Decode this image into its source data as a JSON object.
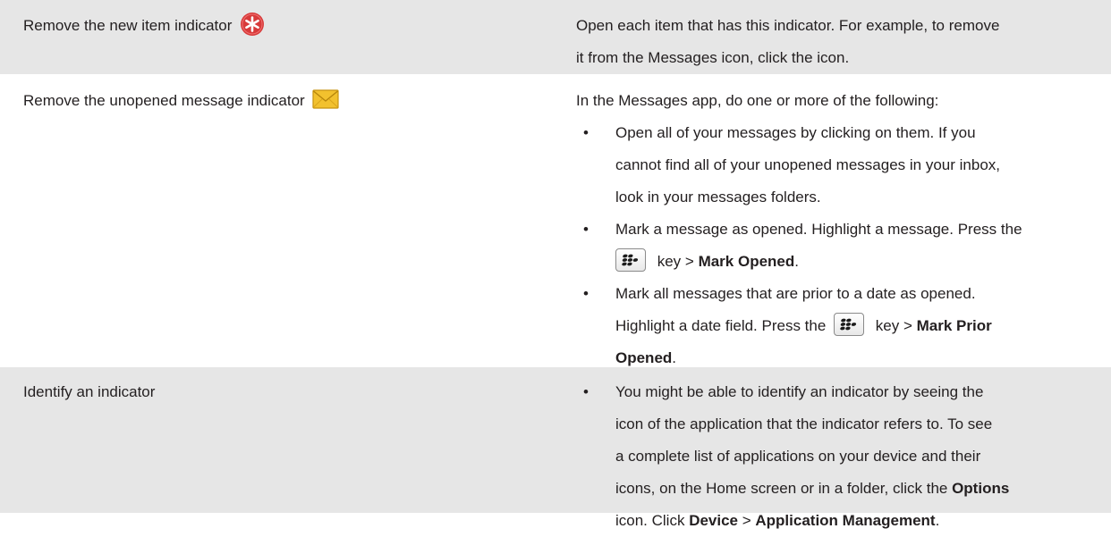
{
  "rows": [
    {
      "left": "Remove the new item indicator",
      "left_icon": "new-item-indicator-icon",
      "right": {
        "lines": [
          "Open each item that has this indicator. For example, to remove",
          "it from the Messages icon, click the icon."
        ]
      }
    },
    {
      "left": "Remove the unopened message indicator",
      "left_icon": "unopened-message-envelope-icon",
      "right": {
        "intro": "In the Messages app, do one or more of the following:",
        "bullets": [
          {
            "lines": [
              "Open all of your messages by clicking on them. If you",
              "cannot find all of your unopened messages in your inbox,",
              "look in your messages folders."
            ]
          },
          {
            "line1": "Mark a message as opened. Highlight a message. Press the",
            "key_suffix": " key > ",
            "bold": "Mark Opened",
            "end": "."
          },
          {
            "line1": "Mark all messages that are prior to a date as opened.",
            "line2_pre": "Highlight a date field. Press the",
            "key_suffix": " key > ",
            "bold_a": "Mark Prior",
            "bold_b": "Opened",
            "end": "."
          }
        ]
      }
    },
    {
      "left": "Identify an indicator",
      "right": {
        "bullets": [
          {
            "lines": [
              "You might be able to identify an indicator by seeing the",
              "icon of the application that the indicator refers to. To see",
              "a complete list of applications on your device and their"
            ],
            "line4_pre": "icons, on the Home screen or in a folder, click the ",
            "line4_bold": "Options",
            "line5_pre": "icon. Click ",
            "line5_bold_a": "Device",
            "line5_mid": " > ",
            "line5_bold_b": "Application Management",
            "line5_end": "."
          }
        ]
      }
    }
  ],
  "bullet_char": "•",
  "colors": {
    "row_shade": "#e6e6e6",
    "text": "#231f20",
    "indicator_red": "#d83a3a",
    "envelope_yellow": "#f2c12e"
  }
}
